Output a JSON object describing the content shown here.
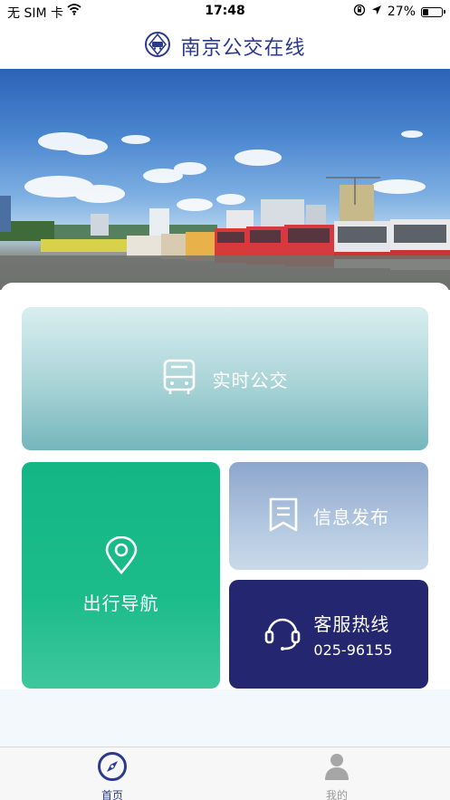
{
  "status_bar": {
    "carrier": "无 SIM 卡",
    "time": "17:48",
    "battery": "27%",
    "battery_level": 0.27
  },
  "header": {
    "title": "南京公交在线"
  },
  "cards": {
    "realtime": {
      "label": "实时公交",
      "icon": "bus-icon"
    },
    "navigation": {
      "label": "出行导航",
      "icon": "location-pin-icon"
    },
    "info": {
      "label": "信息发布",
      "icon": "bookmark-icon"
    },
    "service": {
      "label": "客服热线",
      "phone": "025-96155",
      "icon": "headset-icon"
    }
  },
  "tab_bar": {
    "items": [
      {
        "label": "首页",
        "icon": "compass-icon",
        "active": true
      },
      {
        "label": "我的",
        "icon": "user-icon",
        "active": false
      }
    ]
  },
  "colors": {
    "brand": "#2b3a8c",
    "nav_green": "#1cbc8a",
    "service_navy": "#24266f"
  }
}
